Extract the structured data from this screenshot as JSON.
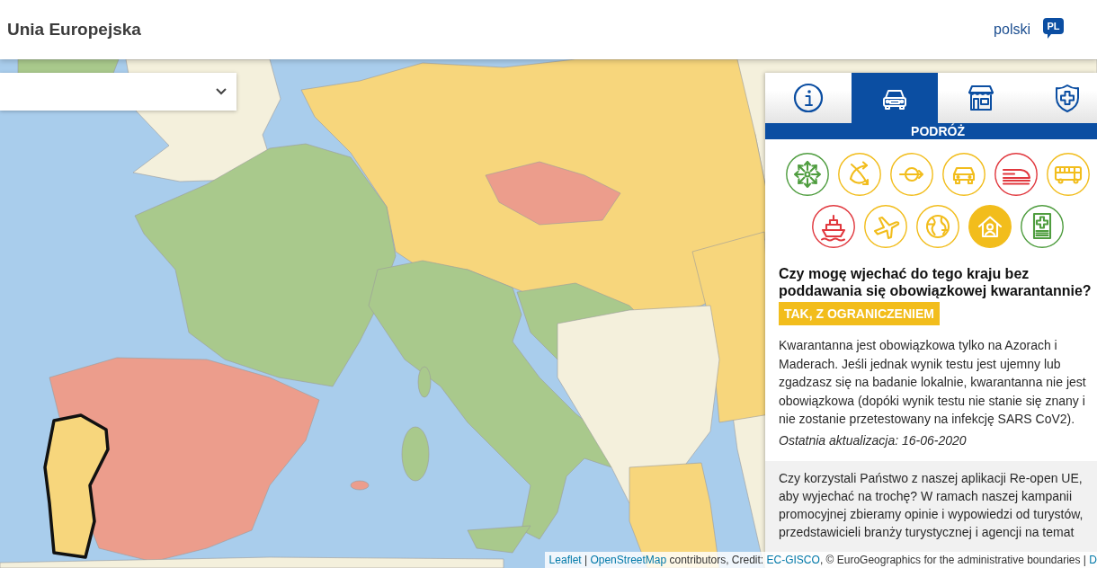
{
  "header": {
    "title": "Unia Europejska",
    "language": {
      "label": "polski",
      "code": "PL"
    }
  },
  "country_select": {
    "expanded": false
  },
  "panel": {
    "tabs": [
      {
        "kind": "info",
        "selected": false
      },
      {
        "kind": "travel",
        "selected": true
      },
      {
        "kind": "shop",
        "selected": false
      },
      {
        "kind": "health",
        "selected": false
      }
    ],
    "section_title": "PODRÓŻ",
    "travel_icons": [
      {
        "kind": "spread",
        "color": "#4f9d3f",
        "selected": false
      },
      {
        "kind": "crossed",
        "color": "#f2bd1c",
        "selected": false
      },
      {
        "kind": "transit",
        "color": "#f2bd1c",
        "selected": false
      },
      {
        "kind": "car",
        "color": "#f2bd1c",
        "selected": false
      },
      {
        "kind": "train",
        "color": "#e1383e",
        "selected": false
      },
      {
        "kind": "bus",
        "color": "#f2bd1c",
        "selected": false
      },
      {
        "kind": "ship",
        "color": "#e1383e",
        "selected": false
      },
      {
        "kind": "plane",
        "color": "#f2bd1c",
        "selected": false
      },
      {
        "kind": "globe",
        "color": "#f2bd1c",
        "selected": false
      },
      {
        "kind": "home",
        "color": "#f2bd1c",
        "selected": true
      },
      {
        "kind": "medical",
        "color": "#4f9d3f",
        "selected": false
      }
    ],
    "question": "Czy mogę wjechać do tego kraju bez poddawania się obowiązkowej kwarantannie?",
    "answer": "TAK, Z OGRANICZENIEM",
    "details": "Kwarantanna jest obowiązkowa tylko na Azorach i Maderach. Jeśli jednak wynik testu jest ujemny lub zgadzasz się na badanie lokalnie, kwarantanna nie jest obowiązkowa (dopóki wynik testu nie stanie się znany i nie zostanie przetestowany na infekcję SARS CoV2).",
    "updated": "Ostatnia aktualizacja: 16-06-2020",
    "survey_text": "Czy korzystali Państwo z naszej aplikacji Re-open UE, aby wyjechać na trochę? W ramach naszej kampanii promocyjnej zbieramy opinie i wypowiedzi od turystów, przedstawicieli branży turystycznej i agencji na temat"
  },
  "attribution": [
    {
      "kind": "link",
      "text": "Leaflet"
    },
    {
      "kind": "text",
      "text": " | "
    },
    {
      "kind": "link",
      "text": "OpenStreetMap"
    },
    {
      "kind": "text",
      "text": " contributors, Credit: "
    },
    {
      "kind": "link",
      "text": "EC-GISCO"
    },
    {
      "kind": "text",
      "text": ", © EuroGeographics for the administrative boundaries | "
    },
    {
      "kind": "link",
      "text": "D"
    }
  ]
}
